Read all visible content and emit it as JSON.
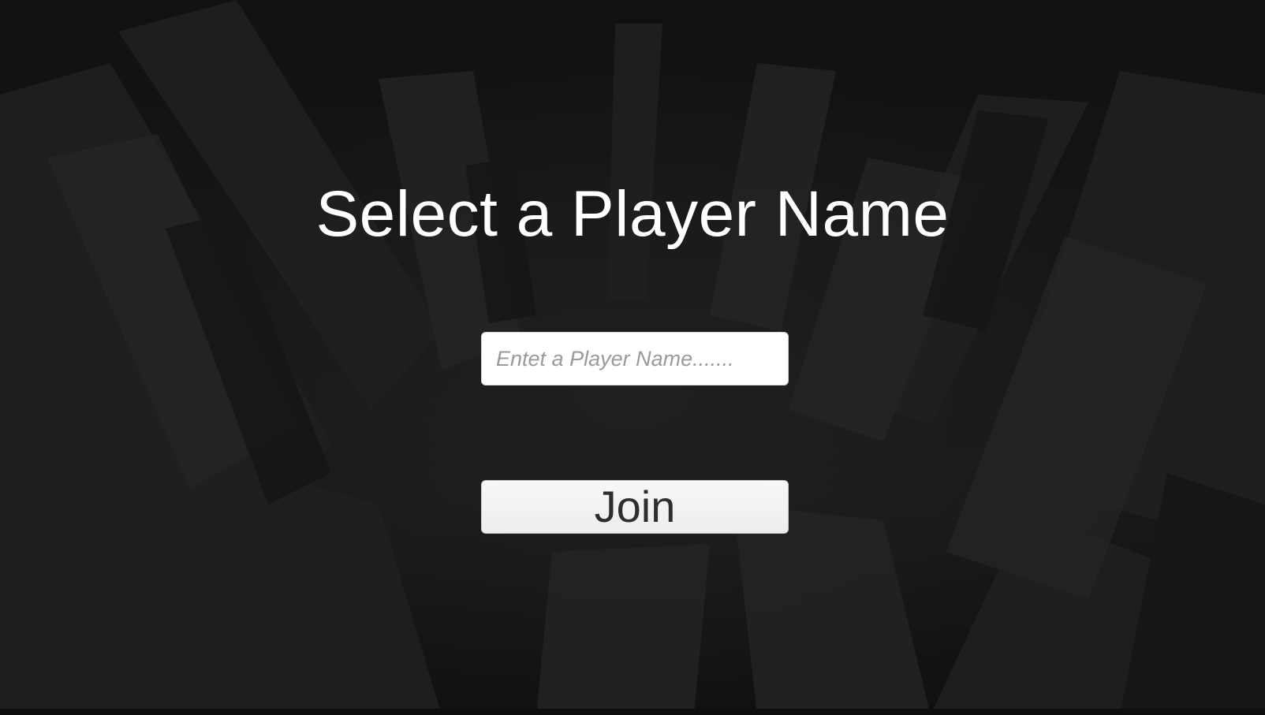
{
  "screen": {
    "title": "Select a Player Name",
    "background": "dark aerial city skyline"
  },
  "player_name_input": {
    "value": "",
    "placeholder": "Entet a Player Name......."
  },
  "join_button": {
    "label": "Join"
  },
  "colors": {
    "background": "#151616",
    "title_text": "#ffffff",
    "input_background": "#ffffff",
    "placeholder_text": "#9a9a9a",
    "button_background": "#f2f2f2",
    "button_text": "#2e2e2e"
  }
}
